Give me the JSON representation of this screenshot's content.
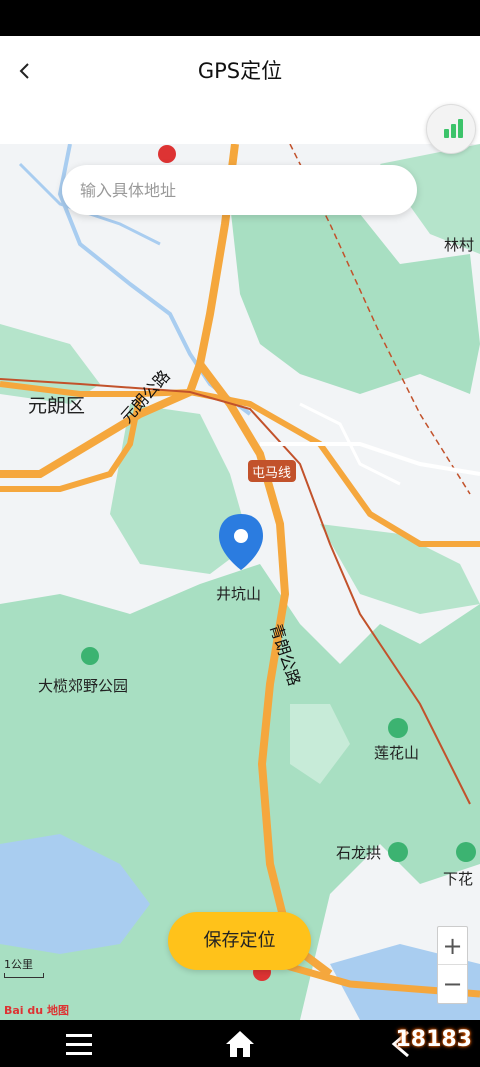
{
  "header": {
    "title": "GPS定位",
    "back_icon": "chevron-left-icon"
  },
  "search": {
    "placeholder": "输入具体地址"
  },
  "map": {
    "labels": {
      "yuenlong": "元朗区",
      "yuenlong_road": "元朗公路",
      "tuenma_line": "屯马线",
      "jingkengshan": "井坑山",
      "tailam_park": "大榄郊野公园",
      "tsinglong_road": "青朗公路",
      "linfashan": "莲花山",
      "shilonggong": "石龙拱",
      "lamtsuen": "林村",
      "hafa": "下花"
    },
    "scale": "1公里",
    "logo": "Bai du 地图",
    "colors": {
      "forest": "#a8dfc2",
      "water": "#a9cdf0",
      "highway": "#f5a73d",
      "rail": "#c2522b"
    }
  },
  "buttons": {
    "save": "保存定位",
    "zoom_in": "+",
    "zoom_out": "−"
  },
  "watermark": "18183"
}
